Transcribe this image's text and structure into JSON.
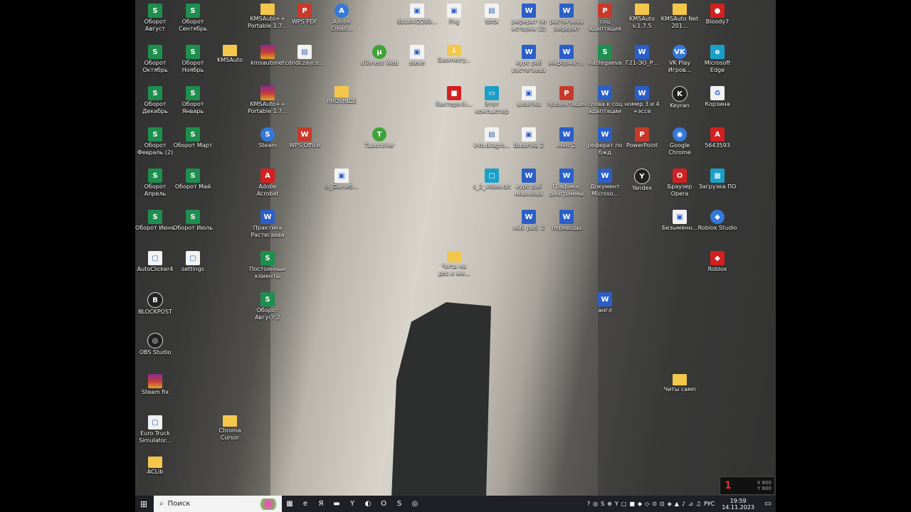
{
  "desktop_icons": [
    {
      "label": "Оборот Август",
      "type": "sheet",
      "glyph": "S"
    },
    {
      "label": "Оборот Сентябрь",
      "type": "sheet",
      "glyph": "S"
    },
    {
      "label": "KMSAuto++ Portable 1.7...",
      "type": "folder",
      "glyph": ""
    },
    {
      "label": "WPS PDF",
      "type": "ppt",
      "glyph": "P"
    },
    {
      "label": "Adobe Creati...",
      "type": "app",
      "glyph": "A"
    },
    {
      "label": "8b164f2289...",
      "type": "file",
      "glyph": "▣"
    },
    {
      "label": "Png",
      "type": "file",
      "glyph": "▣"
    },
    {
      "label": "tbftx",
      "type": "file",
      "glyph": "▤"
    },
    {
      "label": "реферат по истории (2)",
      "type": "word",
      "glyph": "W"
    },
    {
      "label": "растегаева реферат",
      "type": "word",
      "glyph": "W"
    },
    {
      "label": "соц адаптация",
      "type": "ppt",
      "glyph": "P"
    },
    {
      "label": "KMSAuto v.1.7.5",
      "type": "folder",
      "glyph": ""
    },
    {
      "label": "KMSAuto Net 201...",
      "type": "folder",
      "glyph": ""
    },
    {
      "label": "Bloody7",
      "type": "red",
      "glyph": "●"
    },
    {
      "label": "Оборот Октябрь",
      "type": "sheet",
      "glyph": "S"
    },
    {
      "label": "Оборот Ноябрь",
      "type": "sheet",
      "glyph": "S"
    },
    {
      "label": "KMSAuto",
      "type": "folder",
      "glyph": ""
    },
    {
      "label": "kmsautonet",
      "type": "zip",
      "glyph": ""
    },
    {
      "label": "cdndl.zayce...",
      "type": "file",
      "glyph": "▤"
    },
    {
      "label": "uTorrent Web",
      "type": "green",
      "glyph": "µ"
    },
    {
      "label": "steve",
      "type": "file",
      "glyph": "▣"
    },
    {
      "label": "Geometry...",
      "type": "folder",
      "glyph": "↓"
    },
    {
      "label": "курс раб растегаева",
      "type": "word",
      "glyph": "W"
    },
    {
      "label": "информат...",
      "type": "word",
      "glyph": "W"
    },
    {
      "label": "Rastegaeva",
      "type": "sheet",
      "glyph": "S"
    },
    {
      "label": "Г21-ЭО_Р...",
      "type": "word",
      "glyph": "W"
    },
    {
      "label": "VK Play Игров...",
      "type": "app",
      "glyph": "VK"
    },
    {
      "label": "Microsoft Edge",
      "type": "teal",
      "glyph": "e"
    },
    {
      "label": "Оборот Декабрь",
      "type": "sheet",
      "glyph": "S"
    },
    {
      "label": "Оборот Январь",
      "type": "sheet",
      "glyph": "S"
    },
    {
      "label": "KMSAuto++ Portable 1.7...",
      "type": "zip",
      "glyph": ""
    },
    {
      "label": "PROVINCE",
      "type": "folder",
      "glyph": ""
    },
    {
      "label": "Rектерs-lh...",
      "type": "red",
      "glyph": "■"
    },
    {
      "label": "Этот компьютер",
      "type": "teal",
      "glyph": "▭"
    },
    {
      "label": "визитка",
      "type": "file",
      "glyph": "▣"
    },
    {
      "label": "презентация",
      "type": "ppt",
      "glyph": "P"
    },
    {
      "label": "слова к соц адаптации",
      "type": "word",
      "glyph": "W"
    },
    {
      "label": "номер 3 и 4 +эссе",
      "type": "word",
      "glyph": "W"
    },
    {
      "label": "Keyran",
      "type": "dark",
      "glyph": "K"
    },
    {
      "label": "Корзина",
      "type": "file",
      "glyph": "♻"
    },
    {
      "label": "Оборот Февраль (2)",
      "type": "sheet",
      "glyph": "S"
    },
    {
      "label": "Оборот Март",
      "type": "sheet",
      "glyph": "S"
    },
    {
      "label": "Steam",
      "type": "app",
      "glyph": "S"
    },
    {
      "label": "WPS Office",
      "type": "ppt",
      "glyph": "W"
    },
    {
      "label": "TLauncher",
      "type": "green",
      "glyph": "T"
    },
    {
      "label": "info.dragro...",
      "type": "file",
      "glyph": "▤"
    },
    {
      "label": "Визитка 2",
      "type": "file",
      "glyph": "▣"
    },
    {
      "label": "кейс 2",
      "type": "word",
      "glyph": "W"
    },
    {
      "label": "реферат по бжд",
      "type": "word",
      "glyph": "W"
    },
    {
      "label": "PowerPoint",
      "type": "ppt",
      "glyph": "P"
    },
    {
      "label": "Google Chrome",
      "type": "app",
      "glyph": "◉"
    },
    {
      "label": "5643593",
      "type": "red",
      "glyph": "A"
    },
    {
      "label": "Оборот Апрель",
      "type": "sheet",
      "glyph": "S"
    },
    {
      "label": "Оборот Май",
      "type": "sheet",
      "glyph": "S"
    },
    {
      "label": "Adobe Acrobat",
      "type": "red",
      "glyph": "A"
    },
    {
      "label": "sl_GameS...",
      "type": "file",
      "glyph": "▣"
    },
    {
      "label": "c_2_video.txt",
      "type": "teal",
      "glyph": "▢"
    },
    {
      "label": "курс раб новикова",
      "type": "word",
      "glyph": "W"
    },
    {
      "label": "Графики, диаграммы",
      "type": "word",
      "glyph": "W"
    },
    {
      "label": "Документ Microso...",
      "type": "word",
      "glyph": "W"
    },
    {
      "label": "Yandex",
      "type": "dark",
      "glyph": "Y"
    },
    {
      "label": "Браузер Opera",
      "type": "red",
      "glyph": "O"
    },
    {
      "label": "Загрузка ПО",
      "type": "teal",
      "glyph": "▦"
    },
    {
      "label": "Оборот Июнь",
      "type": "sheet",
      "glyph": "S"
    },
    {
      "label": "Оборот Июль",
      "type": "sheet",
      "glyph": "S"
    },
    {
      "label": "Практика Растегаева",
      "type": "word",
      "glyph": "W"
    },
    {
      "label": "лаб. раб. 2",
      "type": "word",
      "glyph": "W"
    },
    {
      "label": "переводы",
      "type": "word",
      "glyph": "W"
    },
    {
      "label": "Безымянн...",
      "type": "file",
      "glyph": "▣"
    },
    {
      "label": "Roblox Studio",
      "type": "app",
      "glyph": "◆"
    },
    {
      "label": "AutoClicker4",
      "type": "file",
      "glyph": "▢"
    },
    {
      "label": "settings",
      "type": "file",
      "glyph": "▢"
    },
    {
      "label": "Постоянные клиенты",
      "type": "sheet",
      "glyph": "S"
    },
    {
      "label": "Читы на дос.я же...",
      "type": "folder",
      "glyph": ""
    },
    {
      "label": "Roblox",
      "type": "red",
      "glyph": "◆"
    },
    {
      "label": "BLOCKPOST",
      "type": "dark",
      "glyph": "B"
    },
    {
      "label": "Оборот Август 2",
      "type": "sheet",
      "glyph": "S"
    },
    {
      "label": "англ",
      "type": "word",
      "glyph": "W"
    },
    {
      "label": "OBS Studio",
      "type": "dark",
      "glyph": "◎"
    },
    {
      "label": "Steam fix",
      "type": "zip",
      "glyph": ""
    },
    {
      "label": "Читы самп",
      "type": "folder",
      "glyph": ""
    },
    {
      "label": "Euro Truck Simulator...",
      "type": "file",
      "glyph": "▢"
    },
    {
      "label": "Chroma Cursor",
      "type": "folder",
      "glyph": ""
    },
    {
      "label": "ACLib",
      "type": "folder",
      "glyph": ""
    }
  ],
  "overlay": {
    "number": "1",
    "x": "X 800",
    "y": "Y 800"
  },
  "taskbar": {
    "start_glyph": "⊞",
    "search_placeholder": "Поиск",
    "apps": [
      "▦",
      "e",
      "Я",
      "▬",
      "Y",
      "◐",
      "O",
      "S",
      "◎"
    ],
    "tray": [
      "?",
      "◎",
      "S",
      "⊕",
      "Y",
      "▢",
      "■",
      "◆",
      "◇",
      "⊙",
      "⊡",
      "◈",
      "▲",
      "♪",
      "⊿",
      "♫"
    ],
    "language": "РУС",
    "time": "19:59",
    "date": "14.11.2023"
  }
}
